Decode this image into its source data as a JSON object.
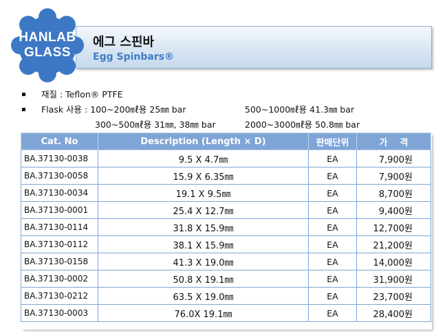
{
  "logo": {
    "line1": "HANLAB",
    "line2": "GLASS",
    "color": "#3d78c4"
  },
  "header": {
    "title_ko": "에그 스핀바",
    "title_en": "Egg Spinbars®"
  },
  "specs": {
    "material": "재질 : Teflon® PTFE",
    "flask_label": "Flask 사용 : 100~200㎖용 25㎜ bar",
    "flask_col2_row1": "500~1000㎖용 41.3㎜ bar",
    "flask_row2_col1": "300~500㎖용 31㎜, 38㎜ bar",
    "flask_row2_col2": "2000~3000㎖용 50.8㎜ bar"
  },
  "table": {
    "headers": [
      "Cat. No",
      "Description  (Length  ×  D)",
      "판매단위",
      "가    격"
    ],
    "rows": [
      [
        "BA.37130-0038",
        "9.5 X 4.7㎜",
        "EA",
        "7,900원"
      ],
      [
        "BA.37130-0058",
        "15.9 X 6.35㎜",
        "EA",
        "7,900원"
      ],
      [
        "BA.37130-0034",
        "19.1 X 9.5㎜",
        "EA",
        "8,700원"
      ],
      [
        "BA.37130-0001",
        "25.4 X 12.7㎜",
        "EA",
        "9,400원"
      ],
      [
        "BA.37130-0114",
        "31.8 X 15.9㎜",
        "EA",
        "12,700원"
      ],
      [
        "BA.37130-0112",
        "38.1 X 15.9㎜",
        "EA",
        "21,200원"
      ],
      [
        "BA.37130-0158",
        "41.3 X 19.0㎜",
        "EA",
        "14,000원"
      ],
      [
        "BA.37130-0002",
        "50.8 X 19.1㎜",
        "EA",
        "31,900원"
      ],
      [
        "BA.37130-0212",
        "63.5 X 19.0㎜",
        "EA",
        "23,700원"
      ],
      [
        "BA.37130-0003",
        "76.0X 19.1㎜",
        "EA",
        "28,400원"
      ]
    ]
  }
}
